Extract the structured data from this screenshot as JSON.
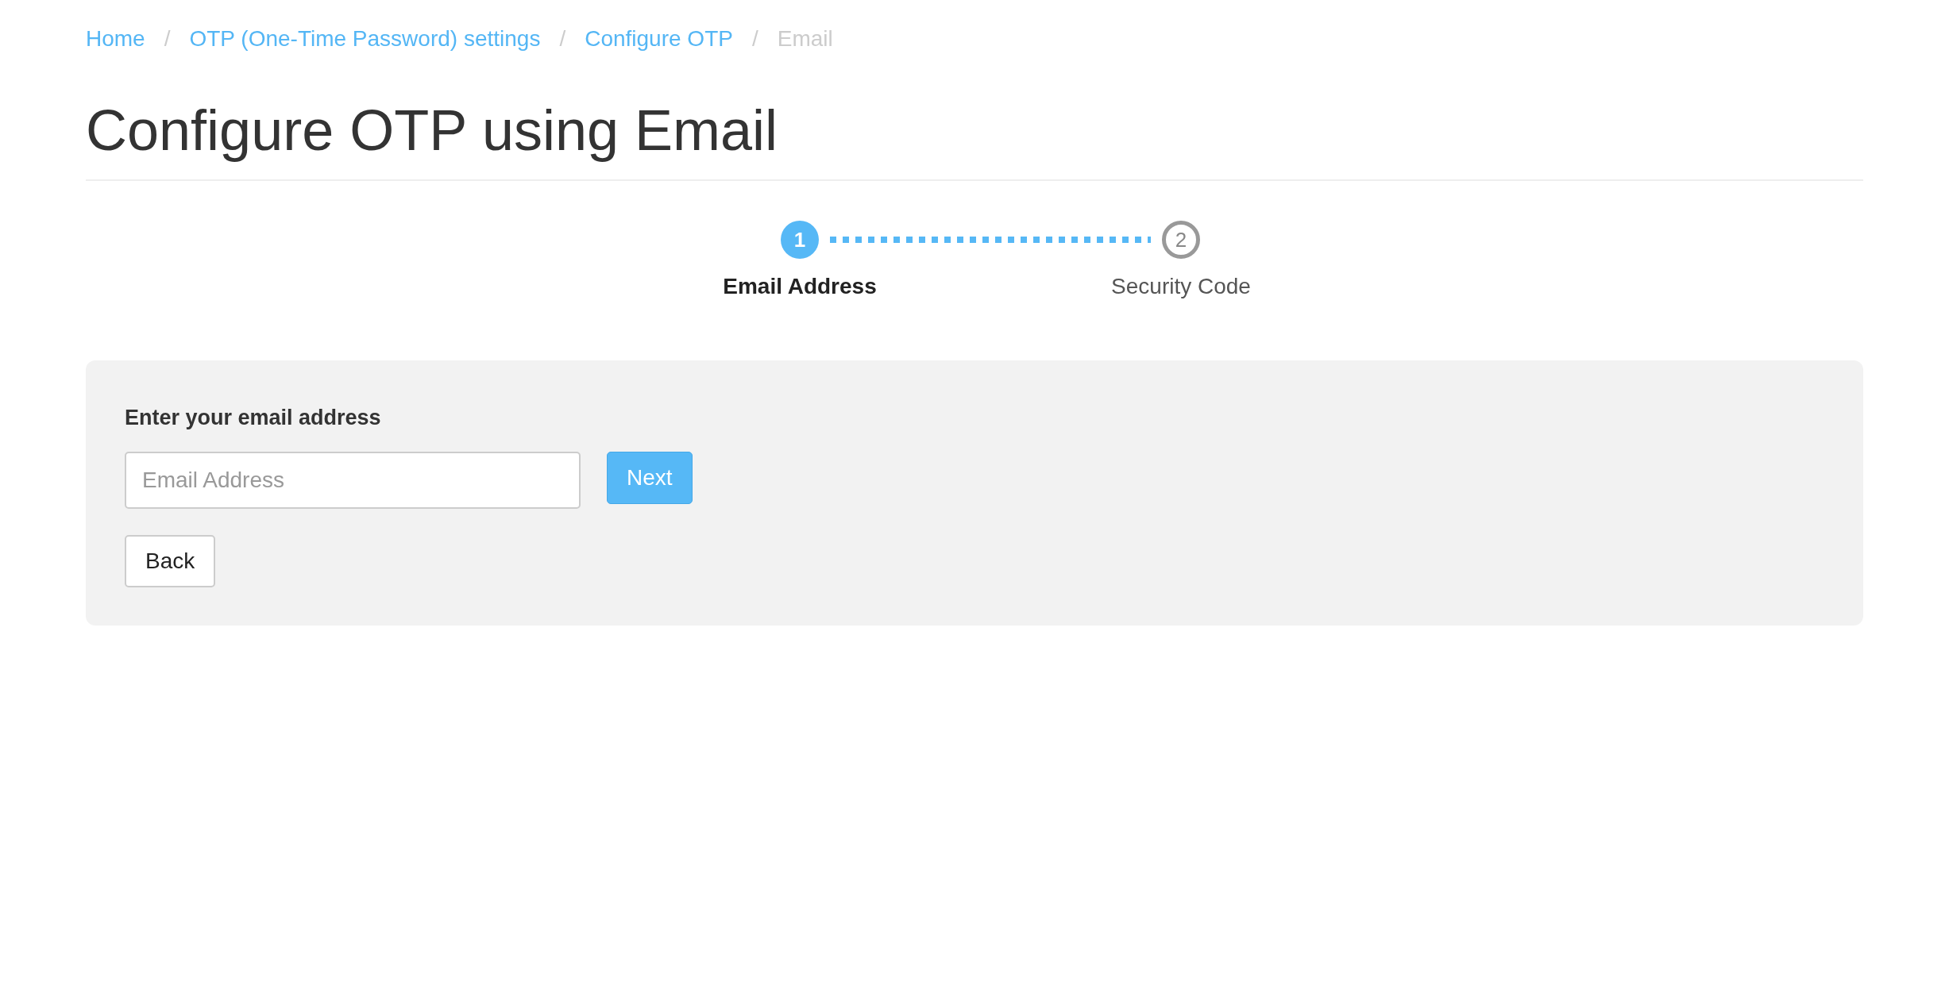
{
  "breadcrumb": [
    {
      "label": "Home",
      "current": false
    },
    {
      "label": "OTP (One-Time Password) settings",
      "current": false
    },
    {
      "label": "Configure OTP",
      "current": false
    },
    {
      "label": "Email",
      "current": true
    }
  ],
  "breadcrumb_separator": "/",
  "title": "Configure OTP using Email",
  "steps": [
    {
      "number": "1",
      "label": "Email Address",
      "selected": true
    },
    {
      "number": "2",
      "label": "Security Code",
      "selected": false
    }
  ],
  "form": {
    "label": "Enter your email address",
    "email": {
      "placeholder": "Email Address"
    },
    "buttons": [
      {
        "label": "Next",
        "kind": "primary"
      },
      {
        "label": "Back",
        "kind": "default"
      }
    ]
  }
}
